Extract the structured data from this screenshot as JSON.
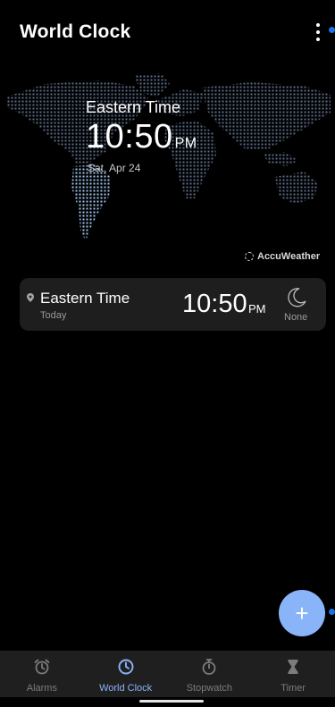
{
  "header": {
    "title": "World Clock"
  },
  "hero": {
    "zone": "Eastern Time",
    "time": "10:50",
    "ampm": "PM",
    "date": "Sat, Apr 24"
  },
  "brand": {
    "label": "AccuWeather"
  },
  "clocks": [
    {
      "zone": "Eastern Time",
      "day": "Today",
      "time": "10:50",
      "ampm": "PM",
      "weather": "None",
      "weather_icon": "moon-icon"
    }
  ],
  "fab": {
    "label": "+"
  },
  "nav": [
    {
      "label": "Alarms",
      "icon": "alarm-clock-icon",
      "active": false
    },
    {
      "label": "World Clock",
      "icon": "clock-icon",
      "active": true
    },
    {
      "label": "Stopwatch",
      "icon": "stopwatch-icon",
      "active": false
    },
    {
      "label": "Timer",
      "icon": "hourglass-icon",
      "active": false
    }
  ],
  "colors": {
    "accent": "#8ab4f8",
    "dot": "#1a73e8",
    "background": "#000000",
    "card": "#1e1e1e",
    "nav": "#1f1f1f"
  }
}
